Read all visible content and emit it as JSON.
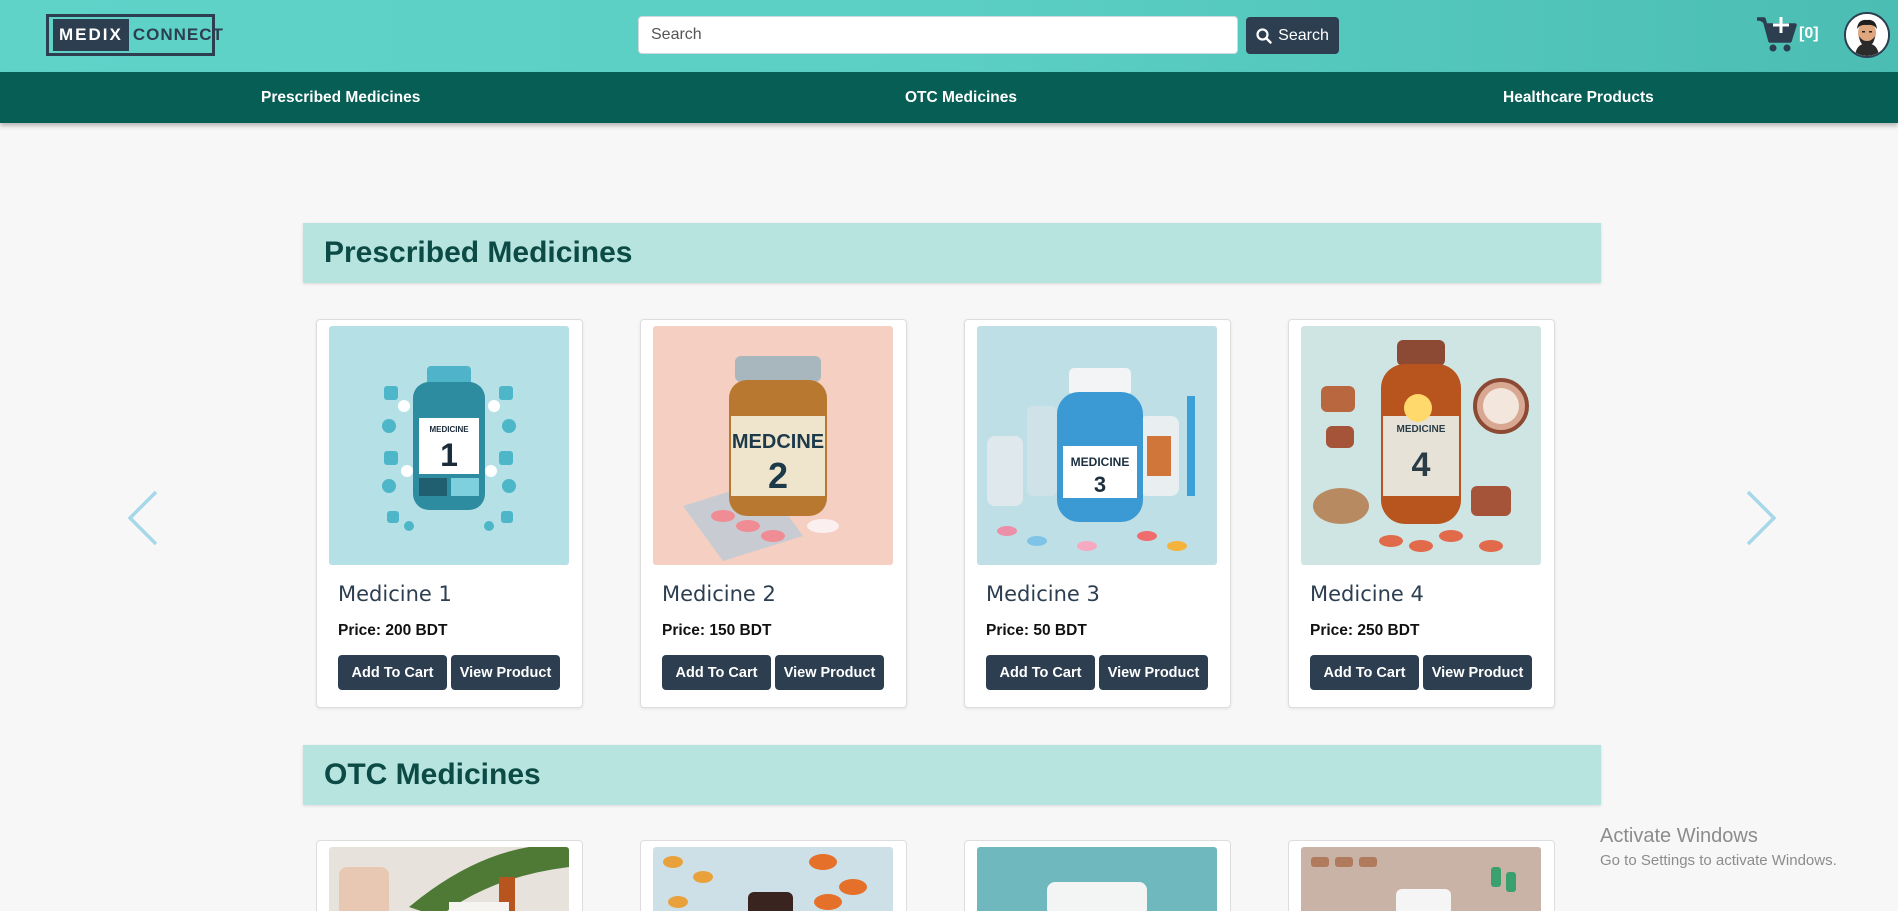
{
  "header": {
    "logo_part1": "MEDIX",
    "logo_part2": "CONNECT",
    "search_placeholder": "Search",
    "search_button": "Search",
    "cart_count": "[0]"
  },
  "nav": {
    "items": [
      "Prescribed Medicines",
      "OTC Medicines",
      "Healthcare Products"
    ]
  },
  "sections": [
    {
      "title": "Prescribed Medicines",
      "products": [
        {
          "name": "Medicine 1",
          "price": "Price: 200 BDT",
          "add": "Add To Cart",
          "view": "View Product",
          "label": "MEDICINE",
          "number": "1"
        },
        {
          "name": "Medicine 2",
          "price": "Price: 150 BDT",
          "add": "Add To Cart",
          "view": "View Product",
          "label": "MEDCINE",
          "number": "2"
        },
        {
          "name": "Medicine 3",
          "price": "Price: 50 BDT",
          "add": "Add To Cart",
          "view": "View Product",
          "label": "MEDICINE",
          "number": "3"
        },
        {
          "name": "Medicine 4",
          "price": "Price: 250 BDT",
          "add": "Add To Cart",
          "view": "View Product",
          "label": "MEDICINE",
          "number": "4"
        }
      ]
    },
    {
      "title": "OTC Medicines"
    }
  ],
  "watermark": {
    "line1": "Activate Windows",
    "line2": "Go to Settings to activate Windows."
  },
  "colors": {
    "header_gradient_start": "#5fd3c8",
    "nav_bg": "#075e54",
    "button_bg": "#2c3e50",
    "section_bg": "#b8e4df"
  }
}
